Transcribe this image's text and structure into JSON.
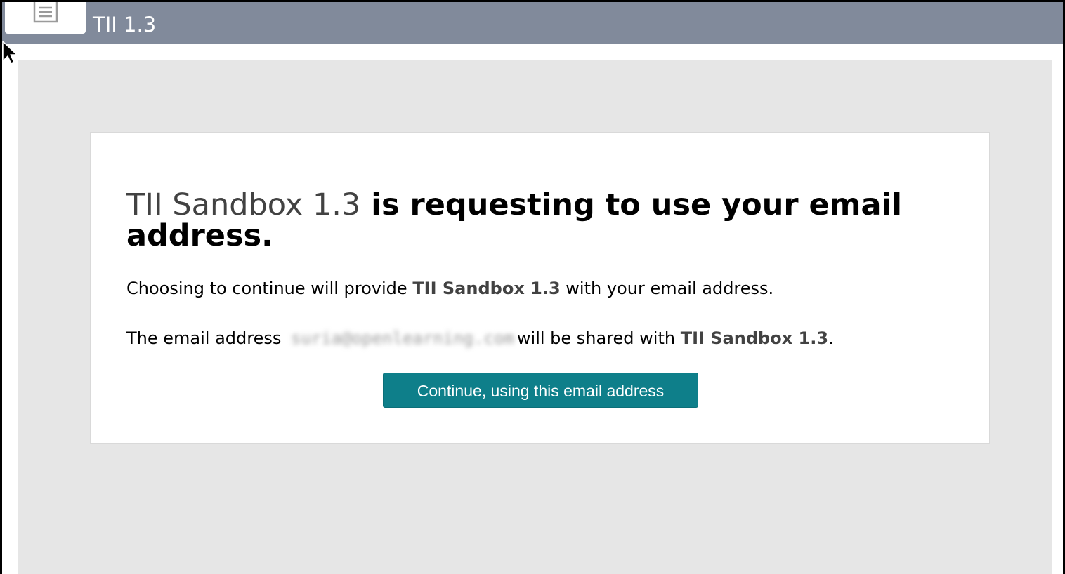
{
  "titlebar": {
    "title": "TII 1.3",
    "icon": "document-icon"
  },
  "consent": {
    "tool_name": "TII Sandbox 1.3",
    "heading_rest": " is requesting to use your email address.",
    "para1_before": "Choosing to continue will provide ",
    "para1_tool": "TII Sandbox 1.3",
    "para1_after": " with your email address.",
    "para2_before": "The email address ",
    "email": "suria@openlearning.com",
    "para2_middle": "will be shared with ",
    "para2_tool": "TII Sandbox 1.3",
    "para2_after": ".",
    "continue_label": "Continue, using this email address"
  },
  "colors": {
    "titlebar": "#818a9b",
    "content_bg": "#e6e6e6",
    "button": "#0e7f8a",
    "tool_name": "#424242"
  }
}
